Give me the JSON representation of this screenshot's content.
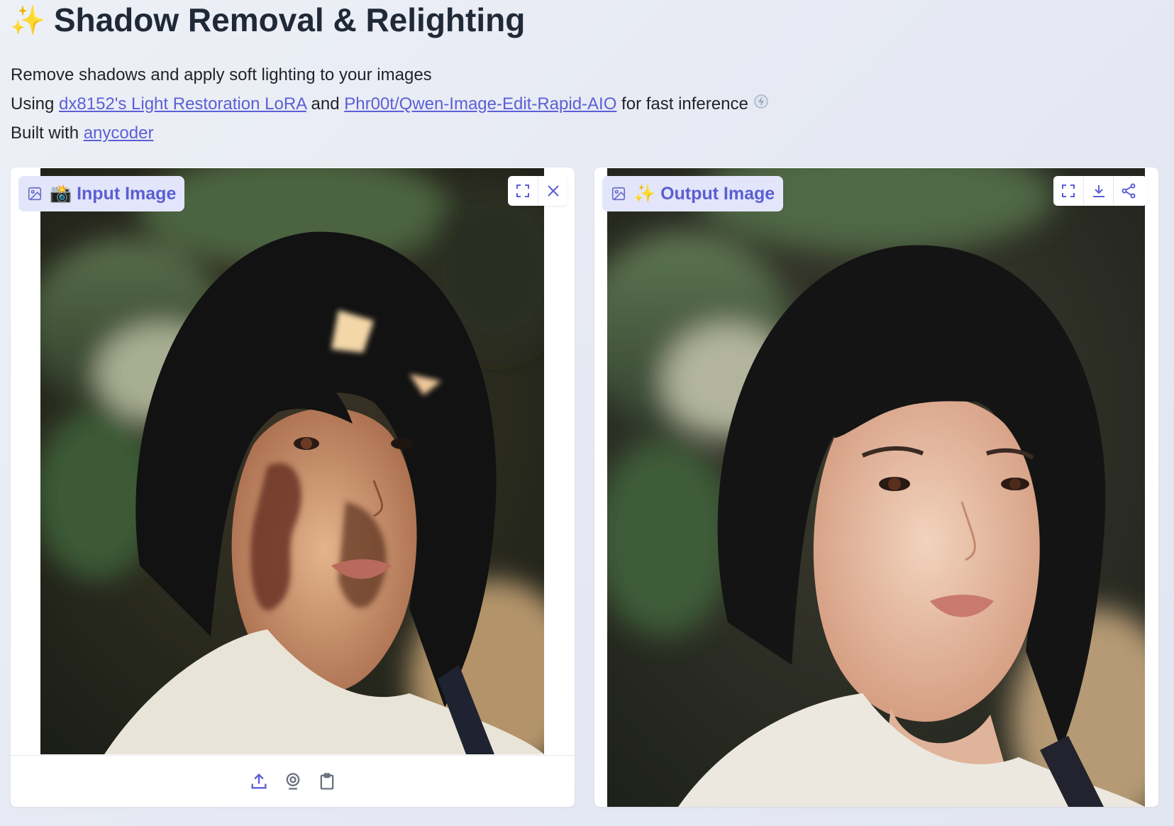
{
  "header": {
    "title": "Shadow Removal & Relighting",
    "sparkle_icon": "sparkles-icon"
  },
  "description": {
    "line1": "Remove shadows and apply soft lighting to your images",
    "line2_prefix": "Using ",
    "lora_link": "dx8152's Light Restoration LoRA",
    "and_text": " and ",
    "model_link": "Phr00t/Qwen-Image-Edit-Rapid-AIO",
    "line2_suffix": " for fast inference ",
    "line3_prefix": "Built with ",
    "anycoder_link": "anycoder"
  },
  "input_panel": {
    "label": "📸 Input Image",
    "tools": [
      "fullscreen-icon",
      "close-icon"
    ],
    "sources": [
      "upload-icon",
      "webcam-icon",
      "clipboard-icon"
    ]
  },
  "output_panel": {
    "label": "✨ Output Image",
    "tools": [
      "fullscreen-icon",
      "download-icon",
      "share-icon"
    ]
  },
  "colors": {
    "accent": "#5b5fd6",
    "chip_bg": "#e3e6fb",
    "background": "#e8ebf4"
  }
}
